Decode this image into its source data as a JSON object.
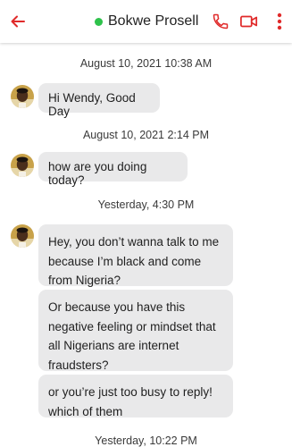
{
  "colors": {
    "accent": "#e02a2a",
    "online": "#2ec24b",
    "bubble": "#e9e9ea"
  },
  "header": {
    "back_icon": "arrow-left-icon",
    "contact_name": "Bokwe Prosell",
    "status": "online",
    "call_icon": "phone-icon",
    "video_icon": "video-camera-icon",
    "menu_icon": "more-vertical-icon"
  },
  "thread": {
    "timestamps": [
      "August 10, 2021 10:38 AM",
      "August 10, 2021 2:14 PM",
      "Yesterday, 4:30 PM",
      "Yesterday, 10:22 PM"
    ],
    "messages": [
      {
        "text": "Hi Wendy, Good Day"
      },
      {
        "text": "how are you doing today?"
      },
      {
        "text": "Hey, you don’t wanna talk to me because I’m black and come from Nigeria?"
      },
      {
        "text": "Or because you have this negative feeling or mindset that all Nigerians are internet fraudsters?"
      },
      {
        "text": "or you’re just too busy to reply! which of them"
      }
    ]
  }
}
